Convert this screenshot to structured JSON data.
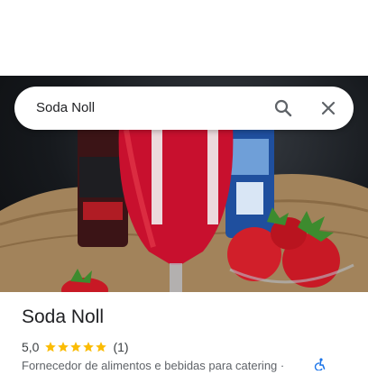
{
  "search": {
    "query": "Soda Noll"
  },
  "place": {
    "name": "Soda Noll",
    "rating": "5,0",
    "stars": 5,
    "review_count": "(1)",
    "category": "Fornecedor de alimentos e bebidas para catering ·"
  },
  "icons": {
    "search": "search-icon",
    "close": "close-icon",
    "star": "star-icon",
    "accessibility": "wheelchair-icon"
  },
  "colors": {
    "star": "#fbbc04",
    "accessibility": "#1a73e8",
    "drink": "#c8102e"
  }
}
